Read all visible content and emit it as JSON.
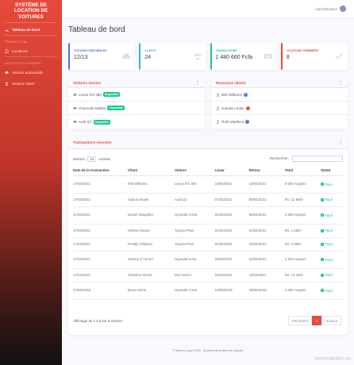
{
  "sidebar": {
    "brand": "SYSTÈME DE LOCATION DE VOITURES",
    "dashboard": "Tableau de bord",
    "heading_transaction": "TRANSACTION",
    "locations": "Locations",
    "heading_master": "MASTER DES DONNÉES",
    "section_car": "Section automobile",
    "section_client": "Section Client"
  },
  "topbar": {
    "user": "Administrateur"
  },
  "page_title": "Tableau de bord",
  "cards": [
    {
      "label": "VOITURES DISPONIBLES",
      "value": "12/13",
      "color": "#4e73df",
      "icon": "car-icon"
    },
    {
      "label": "CLIENTS",
      "value": "24",
      "color": "#36b9cc",
      "icon": "users-icon"
    },
    {
      "label": "TRANSACTIONS",
      "value": "1 480 660 Fcfa",
      "color": "#1cc88a",
      "icon": "money-icon"
    },
    {
      "label": "LOCATIONS TERMINÉES",
      "value": "8",
      "color": "#e74a3b",
      "icon": "check-icon"
    }
  ],
  "new_cars": {
    "title": "Voitures neuves",
    "items": [
      {
        "name": "Lexus RX 350",
        "badge": "Disponible"
      },
      {
        "name": "Chevrolet Malibu",
        "badge": "Disponible"
      },
      {
        "name": "Audi Q7",
        "badge": "Disponible"
      }
    ]
  },
  "new_clients": {
    "title": "Nouveaux clients",
    "items": [
      {
        "name": "Will Williams",
        "color": "#4e73df",
        "mark": "i"
      },
      {
        "name": "Juanita Leako",
        "color": "#e74a3b",
        "mark": "!"
      },
      {
        "name": "Ruth Madison",
        "color": "#4e73df",
        "mark": "i"
      }
    ]
  },
  "transactions": {
    "title": "Transactions récentes",
    "show": "Montrer",
    "entries_value": "10",
    "entries": "entrées",
    "search_label": "Rechercher:",
    "columns": [
      "Date de la transaction",
      "Client",
      "Voiture",
      "Louer",
      "Retour",
      "Total",
      "Statut"
    ],
    "rows": [
      [
        "17/04/2021",
        "Will Williams",
        "Lexus RX 350",
        "18/04/2021",
        "18/04/2021",
        "8 000 roupies",
        "Payé"
      ],
      [
        "17/04/2021",
        "Viola E Neale",
        "Audi Q7",
        "07/04/2021",
        "09/04/2021",
        "Rs. 12 560/-",
        "Payé"
      ],
      [
        "17/04/2021",
        "Daniel Slaughter",
        "Hyundai Creta",
        "04/04/2021",
        "05/04/2021",
        "2 000 roupies",
        "Payé"
      ],
      [
        "17/04/2021",
        "Hélène Moore",
        "Toyota Prius",
        "01/04/2021",
        "02/04/2021",
        "Rs. 1 650/-",
        "Payé"
      ],
      [
        "17/04/2021",
        "Freddy Kirkland",
        "Toyota Prius",
        "01/04/2021",
        "03/04/2021",
        "Rs. 2 900/-",
        "Payé"
      ],
      [
        "17/04/2021",
        "Jeanne Z Turner",
        "Hyundai Kona",
        "20/03/2021",
        "22/03/2021",
        "4 100 roupies",
        "Payé"
      ],
      [
        "17/04/2021",
        "Christine Moore",
        "MG Hector",
        "04/03/2021",
        "11/03/2021",
        "Rs. 13 450/-",
        "Payé"
      ],
      [
        "27/05/2019",
        "Bruno Denn",
        "Hyundai Creta",
        "13/05/2019",
        "29/05/2019",
        "4 000 roupies",
        "Payé"
      ]
    ],
    "info": "Affichage de 1 à 8 sur 8 entrées",
    "prev": "Précédent",
    "page": "1",
    "next": "Suivant"
  },
  "footer": "© Sakura Logrid 2025 - Système de location de voitures",
  "watermark": "senemarket.sn"
}
